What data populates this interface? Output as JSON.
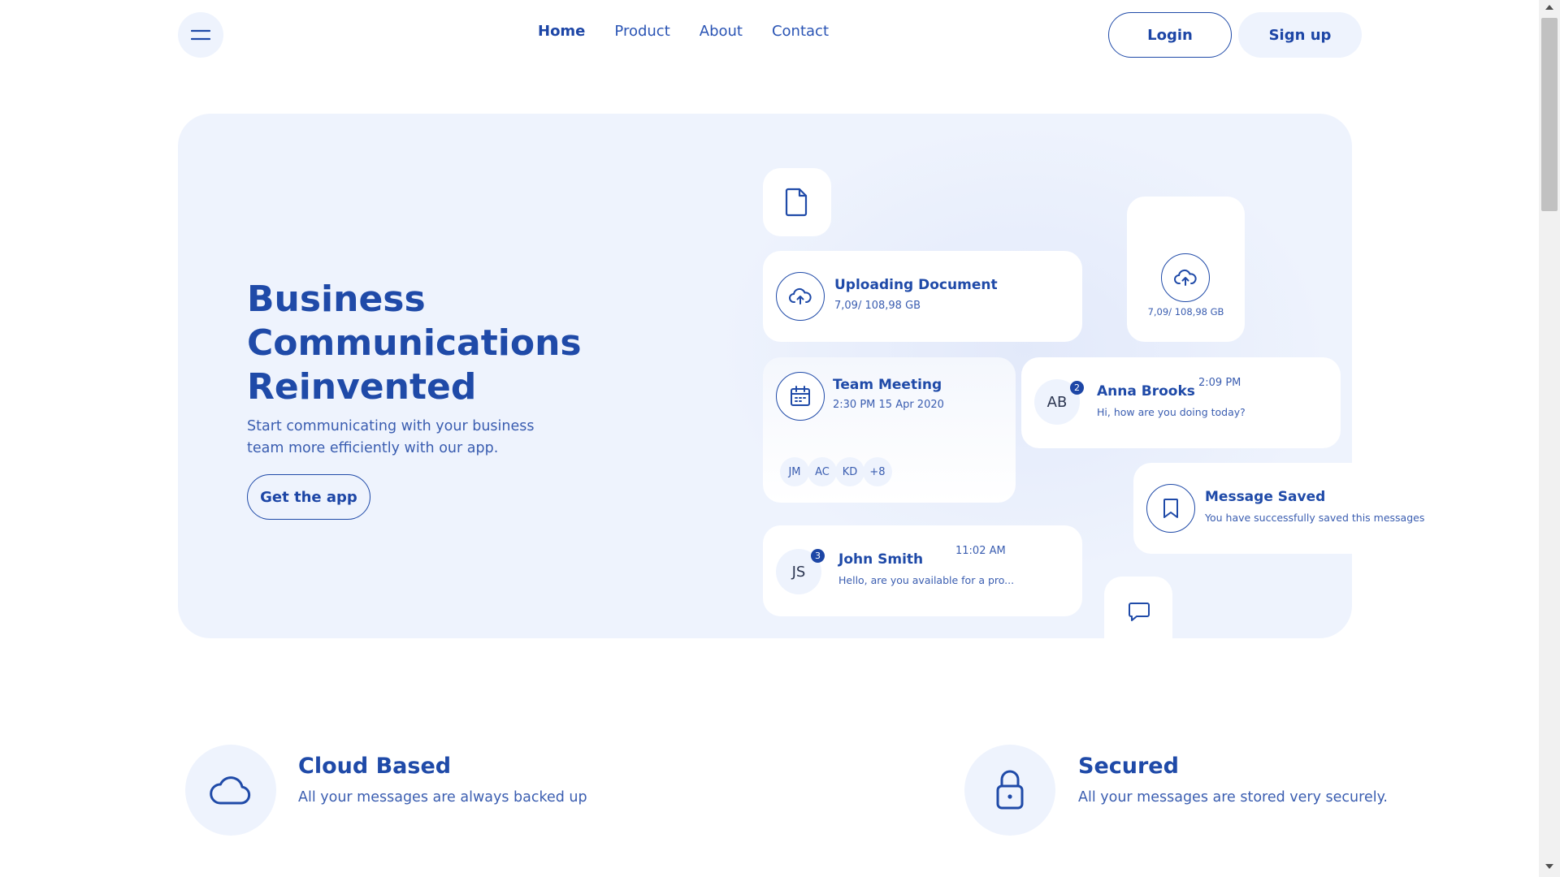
{
  "nav": {
    "links": [
      "Home",
      "Product",
      "About",
      "Contact"
    ],
    "login_label": "Login",
    "signup_label": "Sign up"
  },
  "hero": {
    "title_lines": [
      "Business",
      "Communications",
      "Reinvented"
    ],
    "subtitle_lines": [
      "Start communicating with your business",
      "team more efficiently with our app."
    ],
    "cta_label": "Get the app"
  },
  "cards": {
    "upload": {
      "title": "Uploading Document",
      "progress": "7,09/ 108,98 GB"
    },
    "upload_small": {
      "progress": "7,09/ 108,98 GB"
    },
    "meeting": {
      "title": "Team Meeting",
      "time": "2:30 PM 15 Apr 2020",
      "attendees": [
        "JM",
        "AC",
        "KD",
        "+8"
      ]
    },
    "anna": {
      "initials": "AB",
      "badge": "2",
      "name": "Anna Brooks",
      "time": "2:09 PM",
      "message": "Hi, how are you doing today?"
    },
    "saved": {
      "title": "Message Saved",
      "message": "You have successfully saved this messages"
    },
    "john": {
      "initials": "JS",
      "badge": "3",
      "name": "John Smith",
      "time": "11:02 AM",
      "message": "Hello, are you available for a pro..."
    }
  },
  "features": [
    {
      "icon": "cloud-icon",
      "title": "Cloud Based",
      "text": "All your messages are always backed up"
    },
    {
      "icon": "lock-icon",
      "title": "Secured",
      "text": "All your messages are stored very securely."
    }
  ],
  "colors": {
    "primary": "#1f4aa8",
    "light_bg": "#eef3fd"
  }
}
